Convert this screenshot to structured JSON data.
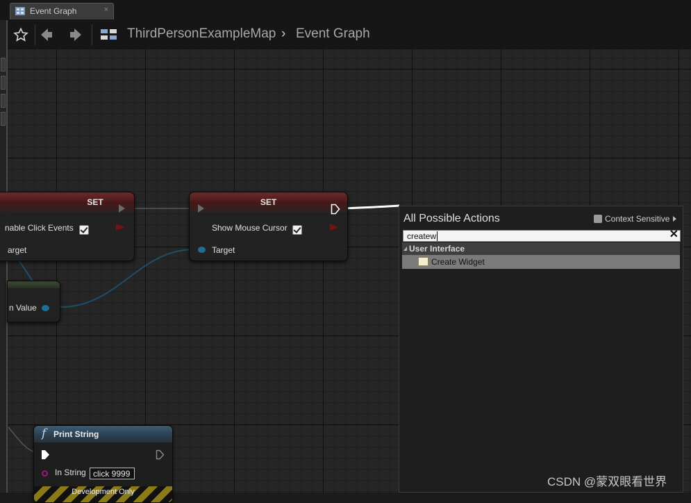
{
  "tab": {
    "title": "Event Graph",
    "close": "×"
  },
  "breadcrumb": {
    "map": "ThirdPersonExampleMap",
    "separator": "›",
    "graph": "Event Graph"
  },
  "nodes": {
    "set_left": {
      "title": "SET",
      "param": "nable Click Events",
      "target": "arget",
      "checked": true
    },
    "set_right": {
      "title": "SET",
      "param": "Show Mouse Cursor",
      "target": "Target",
      "checked": true
    },
    "green": {
      "output": "n Value"
    },
    "print_string": {
      "title": "Print String",
      "func_glyph": "f",
      "param": "In String",
      "value": "click 9999",
      "dev": "Development Only"
    }
  },
  "actions_menu": {
    "title": "All Possible Actions",
    "context_label": "Context Sensitive",
    "context_checked": true,
    "search_value": "createw",
    "category": "User Interface",
    "items": [
      {
        "label": "Create Widget",
        "selected": true
      }
    ]
  },
  "watermark": "CSDN @蒙双眼看世界",
  "colors": {
    "exec_wire": "#ffffff",
    "object_wire": "#1e5a78",
    "accent_set": "#6c2a2a",
    "accent_func": "#3c5c74"
  }
}
